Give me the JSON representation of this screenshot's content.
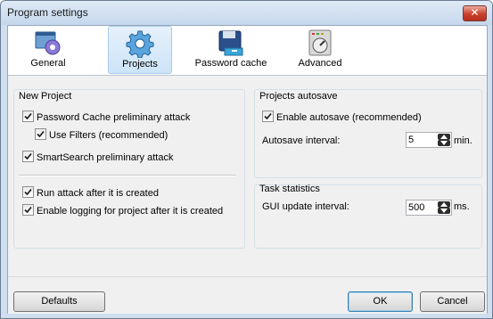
{
  "window": {
    "title": "Program settings",
    "close_glyph": "✕"
  },
  "toolbar": {
    "tabs": [
      {
        "label": "General",
        "icon": "gear-window-icon"
      },
      {
        "label": "Projects",
        "icon": "gear-icon",
        "active": true
      },
      {
        "label": "Password cache",
        "icon": "floppy-drawer-icon"
      },
      {
        "label": "Advanced",
        "icon": "control-panel-icon"
      }
    ]
  },
  "new_project": {
    "title": "New Project",
    "password_cache": {
      "label": "Password Cache preliminary attack",
      "checked": true
    },
    "use_filters": {
      "label": "Use Filters (recommended)",
      "checked": true
    },
    "smartsearch": {
      "label": "SmartSearch preliminary attack",
      "checked": true
    },
    "run_attack": {
      "label": "Run attack after it is created",
      "checked": true
    },
    "enable_logging": {
      "label": "Enable logging for project after it is created",
      "checked": true
    }
  },
  "autosave": {
    "title": "Projects autosave",
    "enable": {
      "label": "Enable autosave (recommended)",
      "checked": true
    },
    "interval_label": "Autosave interval:",
    "interval_value": "5",
    "interval_unit": "min."
  },
  "task_statistics": {
    "title": "Task statistics",
    "gui_label": "GUI update interval:",
    "gui_value": "500",
    "gui_unit": "ms."
  },
  "footer": {
    "defaults": "Defaults",
    "ok": "OK",
    "cancel": "Cancel"
  },
  "colors": {
    "accent": "#3c7fb1",
    "active_tab": "#cde4f8",
    "check": "#1a1a1a"
  }
}
